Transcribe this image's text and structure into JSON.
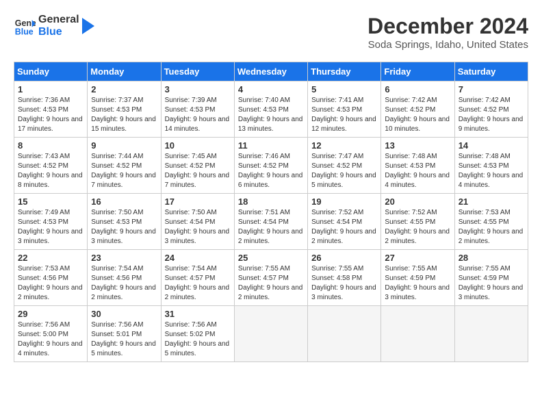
{
  "header": {
    "logo_line1": "General",
    "logo_line2": "Blue",
    "title": "December 2024",
    "subtitle": "Soda Springs, Idaho, United States"
  },
  "weekdays": [
    "Sunday",
    "Monday",
    "Tuesday",
    "Wednesday",
    "Thursday",
    "Friday",
    "Saturday"
  ],
  "weeks": [
    [
      {
        "day": "1",
        "sunrise": "7:36 AM",
        "sunset": "4:53 PM",
        "daylight": "9 hours and 17 minutes."
      },
      {
        "day": "2",
        "sunrise": "7:37 AM",
        "sunset": "4:53 PM",
        "daylight": "9 hours and 15 minutes."
      },
      {
        "day": "3",
        "sunrise": "7:39 AM",
        "sunset": "4:53 PM",
        "daylight": "9 hours and 14 minutes."
      },
      {
        "day": "4",
        "sunrise": "7:40 AM",
        "sunset": "4:53 PM",
        "daylight": "9 hours and 13 minutes."
      },
      {
        "day": "5",
        "sunrise": "7:41 AM",
        "sunset": "4:53 PM",
        "daylight": "9 hours and 12 minutes."
      },
      {
        "day": "6",
        "sunrise": "7:42 AM",
        "sunset": "4:52 PM",
        "daylight": "9 hours and 10 minutes."
      },
      {
        "day": "7",
        "sunrise": "7:42 AM",
        "sunset": "4:52 PM",
        "daylight": "9 hours and 9 minutes."
      }
    ],
    [
      {
        "day": "8",
        "sunrise": "7:43 AM",
        "sunset": "4:52 PM",
        "daylight": "9 hours and 8 minutes."
      },
      {
        "day": "9",
        "sunrise": "7:44 AM",
        "sunset": "4:52 PM",
        "daylight": "9 hours and 7 minutes."
      },
      {
        "day": "10",
        "sunrise": "7:45 AM",
        "sunset": "4:52 PM",
        "daylight": "9 hours and 7 minutes."
      },
      {
        "day": "11",
        "sunrise": "7:46 AM",
        "sunset": "4:52 PM",
        "daylight": "9 hours and 6 minutes."
      },
      {
        "day": "12",
        "sunrise": "7:47 AM",
        "sunset": "4:52 PM",
        "daylight": "9 hours and 5 minutes."
      },
      {
        "day": "13",
        "sunrise": "7:48 AM",
        "sunset": "4:53 PM",
        "daylight": "9 hours and 4 minutes."
      },
      {
        "day": "14",
        "sunrise": "7:48 AM",
        "sunset": "4:53 PM",
        "daylight": "9 hours and 4 minutes."
      }
    ],
    [
      {
        "day": "15",
        "sunrise": "7:49 AM",
        "sunset": "4:53 PM",
        "daylight": "9 hours and 3 minutes."
      },
      {
        "day": "16",
        "sunrise": "7:50 AM",
        "sunset": "4:53 PM",
        "daylight": "9 hours and 3 minutes."
      },
      {
        "day": "17",
        "sunrise": "7:50 AM",
        "sunset": "4:54 PM",
        "daylight": "9 hours and 3 minutes."
      },
      {
        "day": "18",
        "sunrise": "7:51 AM",
        "sunset": "4:54 PM",
        "daylight": "9 hours and 2 minutes."
      },
      {
        "day": "19",
        "sunrise": "7:52 AM",
        "sunset": "4:54 PM",
        "daylight": "9 hours and 2 minutes."
      },
      {
        "day": "20",
        "sunrise": "7:52 AM",
        "sunset": "4:55 PM",
        "daylight": "9 hours and 2 minutes."
      },
      {
        "day": "21",
        "sunrise": "7:53 AM",
        "sunset": "4:55 PM",
        "daylight": "9 hours and 2 minutes."
      }
    ],
    [
      {
        "day": "22",
        "sunrise": "7:53 AM",
        "sunset": "4:56 PM",
        "daylight": "9 hours and 2 minutes."
      },
      {
        "day": "23",
        "sunrise": "7:54 AM",
        "sunset": "4:56 PM",
        "daylight": "9 hours and 2 minutes."
      },
      {
        "day": "24",
        "sunrise": "7:54 AM",
        "sunset": "4:57 PM",
        "daylight": "9 hours and 2 minutes."
      },
      {
        "day": "25",
        "sunrise": "7:55 AM",
        "sunset": "4:57 PM",
        "daylight": "9 hours and 2 minutes."
      },
      {
        "day": "26",
        "sunrise": "7:55 AM",
        "sunset": "4:58 PM",
        "daylight": "9 hours and 3 minutes."
      },
      {
        "day": "27",
        "sunrise": "7:55 AM",
        "sunset": "4:59 PM",
        "daylight": "9 hours and 3 minutes."
      },
      {
        "day": "28",
        "sunrise": "7:55 AM",
        "sunset": "4:59 PM",
        "daylight": "9 hours and 3 minutes."
      }
    ],
    [
      {
        "day": "29",
        "sunrise": "7:56 AM",
        "sunset": "5:00 PM",
        "daylight": "9 hours and 4 minutes."
      },
      {
        "day": "30",
        "sunrise": "7:56 AM",
        "sunset": "5:01 PM",
        "daylight": "9 hours and 5 minutes."
      },
      {
        "day": "31",
        "sunrise": "7:56 AM",
        "sunset": "5:02 PM",
        "daylight": "9 hours and 5 minutes."
      },
      null,
      null,
      null,
      null
    ]
  ]
}
